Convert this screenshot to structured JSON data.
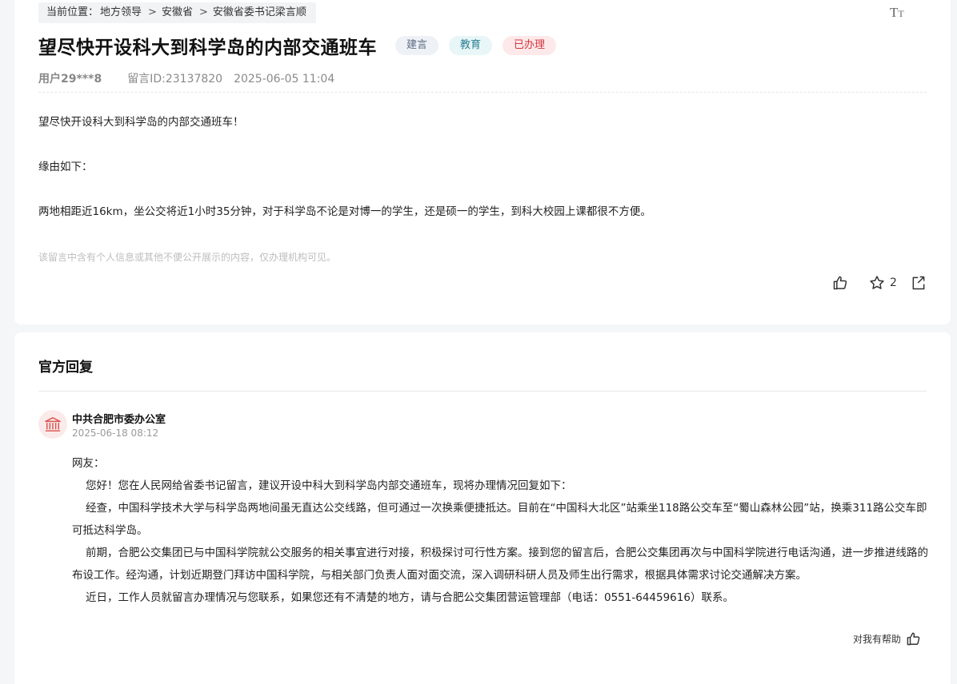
{
  "breadcrumb": {
    "label": "当前位置：",
    "items": [
      "地方领导",
      "安徽省",
      "安徽省委书记梁言顺"
    ],
    "separator": ">"
  },
  "font_toggle": {
    "big": "T",
    "small": "T"
  },
  "message": {
    "title": "望尽快开设科大到科学岛的内部交通班车",
    "tags": [
      "建言",
      "教育",
      "已办理"
    ],
    "user": "用户29***8",
    "message_id": "留言ID:23137820",
    "datetime": "2025-06-05 11:04",
    "paragraphs": [
      "望尽快开设科大到科学岛的内部交通班车！",
      "缘由如下：",
      "两地相距近16km，坐公交将近1小时35分钟，对于科学岛不论是对博一的学生，还是硕一的学生，到科大校园上课都很不方便。"
    ],
    "privacy_note": "该留言中含有个人信息或其他不便公开展示的内容，仅办理机构可见。",
    "favorite_count": "2"
  },
  "reply": {
    "heading": "官方回复",
    "org_name": "中共合肥市委办公室",
    "datetime": "2025-06-18 08:12",
    "greeting": "网友：",
    "paragraphs": [
      "您好！您在人民网给省委书记留言，建议开设中科大到科学岛内部交通班车，现将办理情况回复如下：",
      "经查，中国科学技术大学与科学岛两地间虽无直达公交线路，但可通过一次换乘便捷抵达。目前在“中国科大北区”站乘坐118路公交车至“蜀山森林公园”站，换乘311路公交车即可抵达科学岛。",
      "前期，合肥公交集团已与中国科学院就公交服务的相关事宜进行对接，积极探讨可行性方案。接到您的留言后，合肥公交集团再次与中国科学院进行电话沟通，进一步推进线路的布设工作。经沟通，计划近期登门拜访中国科学院，与相关部门负责人面对面交流，深入调研科研人员及师生出行需求，根据具体需求讨论交通解决方案。",
      "近日，工作人员就留言办理情况与您联系，如果您还有不清楚的地方，请与合肥公交集团营运管理部（电话：0551-64459616）联系。"
    ],
    "helpful_label": "对我有帮助"
  },
  "icons": {
    "like": "thumbs-up-icon",
    "favorite": "star-icon",
    "share": "share-icon",
    "org": "government-building-icon",
    "helpful": "thumbs-up-icon"
  },
  "colors": {
    "tag_suggestion": "#5b6b85",
    "tag_education": "#2b7f93",
    "tag_handled": "#d2363f",
    "org_icon": "#d9534f"
  }
}
